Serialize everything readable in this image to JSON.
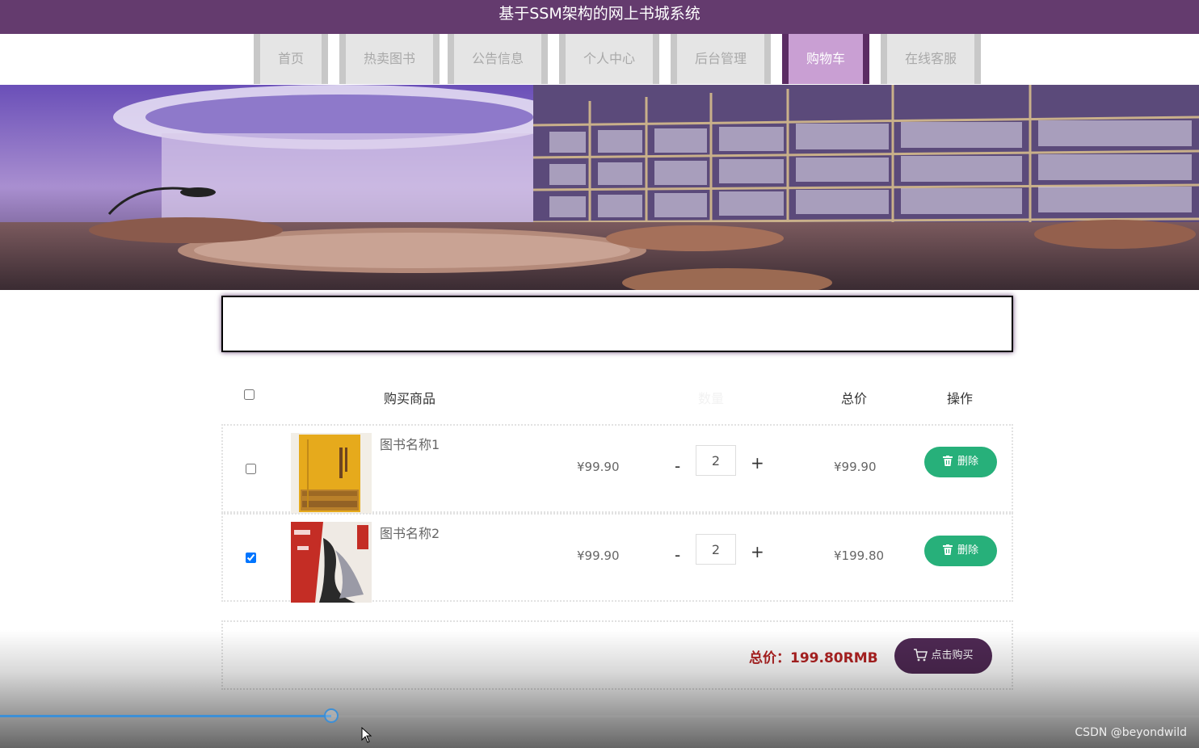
{
  "app": {
    "title": "基于SSM架构的网上书城系统"
  },
  "nav": {
    "items": [
      {
        "label": "首页",
        "active": false
      },
      {
        "label": "热卖图书",
        "active": false
      },
      {
        "label": "公告信息",
        "active": false
      },
      {
        "label": "个人中心",
        "active": false
      },
      {
        "label": "后台管理",
        "active": false
      },
      {
        "label": "购物车",
        "active": true
      },
      {
        "label": "在线客服",
        "active": false
      }
    ]
  },
  "cart": {
    "headers": {
      "product": "购买商品",
      "quantity": "数量",
      "total": "总价",
      "actions": "操作"
    },
    "select_all_checked": false,
    "items": [
      {
        "name": "图书名称1",
        "price": "¥99.90",
        "quantity": "2",
        "total": "¥99.90",
        "checked": false,
        "delete_label": "删除"
      },
      {
        "name": "图书名称2",
        "price": "¥99.90",
        "quantity": "2",
        "total": "¥199.80",
        "checked": true,
        "delete_label": "删除"
      }
    ],
    "summary": {
      "total_text": "总价：199.80RMB",
      "buy_label": "点击购买"
    }
  },
  "video": {
    "progress_fraction": 0.276
  },
  "watermark": "CSDN @beyondwild",
  "colors": {
    "header_bg": "#643b6e",
    "nav_active": "#c99fd3",
    "delete_button": "#27b07a",
    "buy_button": "#4f2954",
    "total_text": "#b22222",
    "progress": "#3d8fd6"
  },
  "icons": {
    "delete": "trash-icon",
    "buy": "cart-icon"
  }
}
